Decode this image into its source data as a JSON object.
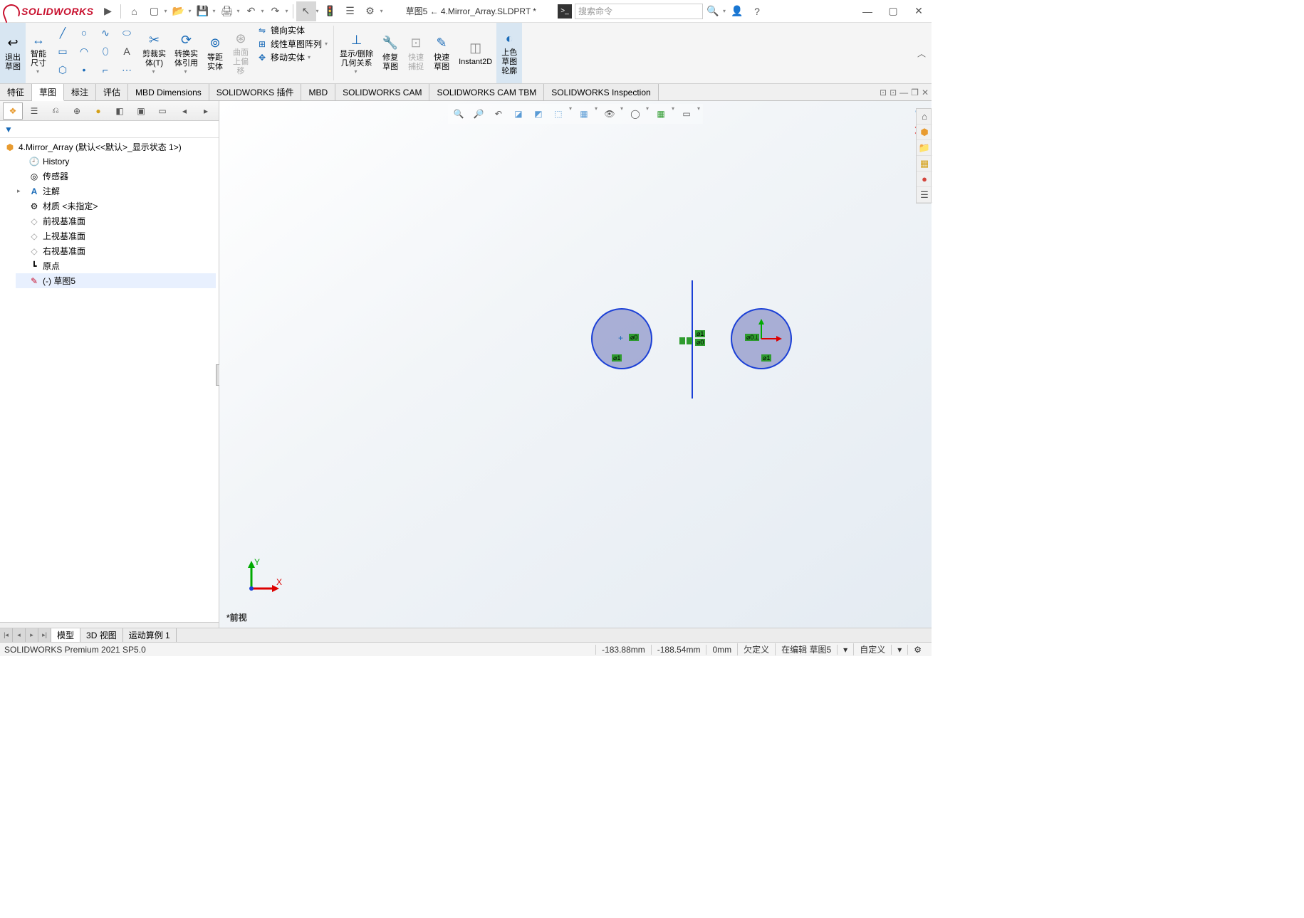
{
  "app": {
    "logo_text": "SOLIDWORKS",
    "doc_title": "草图5 ← 4.Mirror_Array.SLDPRT *",
    "search_placeholder": "搜索命令"
  },
  "ribbon": {
    "exit_sketch": "退出\n草图",
    "smart_dim": "智能\n尺寸",
    "trim": "剪裁实\n体(T)",
    "convert": "转换实\n体引用",
    "offset": "等距\n实体",
    "surface_offset": "曲面\n上偏\n移",
    "mirror": "镜向实体",
    "linear_pattern": "线性草图阵列",
    "move": "移动实体",
    "show_rel": "显示/删除\n几何关系",
    "repair": "修复\n草图",
    "quick_snap": "快速\n捕捉",
    "quick_sketch": "快速\n草图",
    "instant2d": "Instant2D",
    "shaded": "上色\n草图\n轮廓"
  },
  "tabs": [
    "特征",
    "草图",
    "标注",
    "评估",
    "MBD Dimensions",
    "SOLIDWORKS 插件",
    "MBD",
    "SOLIDWORKS CAM",
    "SOLIDWORKS CAM TBM",
    "SOLIDWORKS Inspection"
  ],
  "tree": {
    "root": "4.Mirror_Array  (默认<<默认>_显示状态 1>)",
    "items": [
      {
        "icon": "🕘",
        "label": "History"
      },
      {
        "icon": "◎",
        "label": "传感器"
      },
      {
        "icon": "A",
        "label": "注解",
        "expandable": true
      },
      {
        "icon": "⚙",
        "label": "材质 <未指定>"
      },
      {
        "icon": "◇",
        "label": "前视基准面"
      },
      {
        "icon": "◇",
        "label": "上视基准面"
      },
      {
        "icon": "◇",
        "label": "右视基准面"
      },
      {
        "icon": "┗",
        "label": "原点"
      },
      {
        "icon": "✎",
        "label": "(-) 草图5",
        "editing": true
      }
    ]
  },
  "viewport": {
    "label": "*前视",
    "triad_x": "X",
    "triad_y": "Y"
  },
  "relations": {
    "left_circle": [
      "⌀0",
      "⌀1"
    ],
    "center": [
      "⌀1",
      "⌀0"
    ],
    "right_circle": [
      "⌀0⊥",
      "⌀1"
    ]
  },
  "bottom_tabs": [
    "模型",
    "3D 视图",
    "运动算例 1"
  ],
  "status": {
    "product": "SOLIDWORKS Premium 2021 SP5.0",
    "coord_x": "-183.88mm",
    "coord_y": "-188.54mm",
    "coord_z": "0mm",
    "def": "欠定义",
    "editing": "在编辑 草图5",
    "custom": "自定义"
  }
}
